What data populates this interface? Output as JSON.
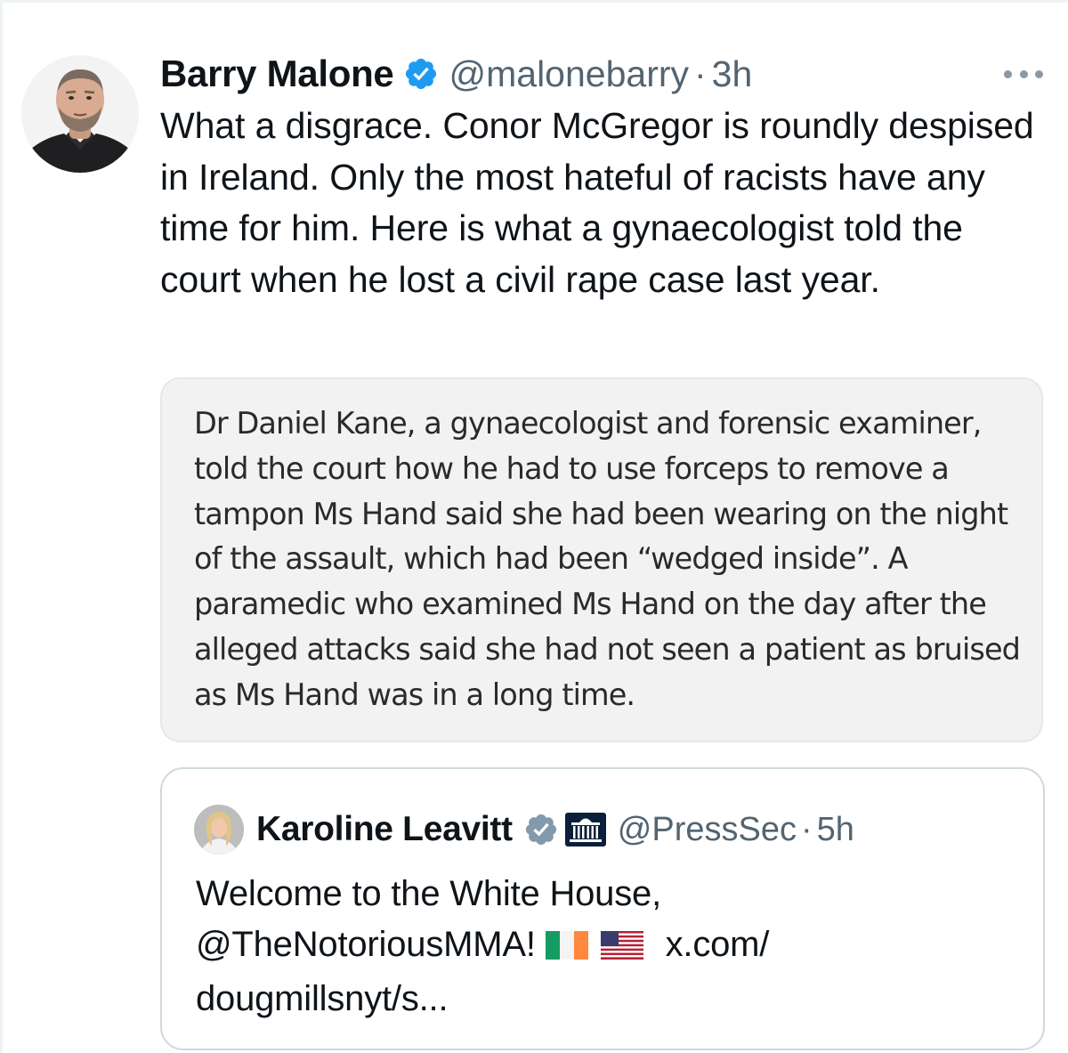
{
  "tweet": {
    "display_name": "Barry Malone",
    "handle": "@malonebarry",
    "separator": "·",
    "time": "3h",
    "avatar_icon": "user-avatar-photo",
    "more_icon": "more-options-icon",
    "verified_icon": "verified-badge-icon",
    "verified_color": "#1d9bf0",
    "text": "What a disgrace. Conor McGregor is roundly despised in Ireland. Only the most hateful of racists have any time for him. Here is what a gynaecologist told the court when he lost a civil rape case last year.",
    "attached_image_text": "Dr Daniel Kane, a gynaecologist and forensic examiner, told the court how he had to use forceps to remove a tampon Ms Hand said she had been wearing on the night of the assault, which had been “wedged inside”. A paramedic who examined Ms Hand on the day after the alleged attacks said she had not seen a patient as bruised as Ms Hand was in a long time."
  },
  "quoted_tweet": {
    "display_name": "Karoline Leavitt",
    "handle": "@PressSec",
    "separator": "·",
    "time": "5h",
    "verified_icon": "government-verified-badge-icon",
    "verified_color": "#829aab",
    "affiliation_icon": "white-house-affiliate-icon",
    "text_line1": "Welcome to the White House,",
    "text_line2_mention": "@TheNotoriousMMA!",
    "flag_ireland_icon": "ireland-flag-icon",
    "flag_us_icon": "us-flag-icon",
    "text_line2_link": "x.com/",
    "text_line3": "dougmillsnyt/s..."
  }
}
